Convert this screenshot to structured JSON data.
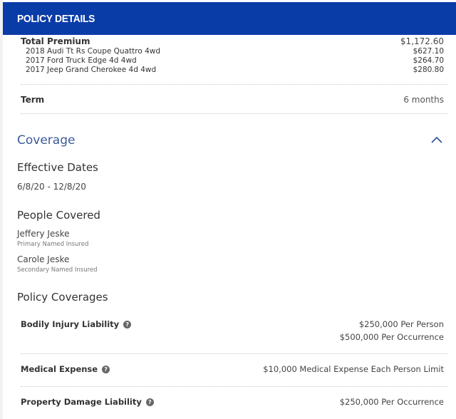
{
  "header": {
    "title": "POLICY DETAILS"
  },
  "premium": {
    "label": "Total Premium",
    "amount": "$1,172.60",
    "vehicles": [
      {
        "name": "2018 Audi Tt Rs Coupe Quattro 4wd",
        "amount": "$627.10"
      },
      {
        "name": "2017 Ford Truck Edge 4d 4wd",
        "amount": "$264.70"
      },
      {
        "name": "2017 Jeep Grand Cherokee 4d 4wd",
        "amount": "$280.80"
      }
    ]
  },
  "term": {
    "label": "Term",
    "value": "6 months"
  },
  "coverage": {
    "title": "Coverage",
    "effective": {
      "title": "Effective Dates",
      "value": "6/8/20 - 12/8/20"
    },
    "people": {
      "title": "People Covered",
      "list": [
        {
          "name": "Jeffery Jeske",
          "role": "Primary Named Insured"
        },
        {
          "name": "Carole Jeske",
          "role": "Secondary Named Insured"
        }
      ]
    },
    "policy": {
      "title": "Policy Coverages",
      "items": [
        {
          "label": "Bodily Injury Liability",
          "values": [
            "$250,000 Per Person",
            "$500,000 Per Occurrence"
          ]
        },
        {
          "label": "Medical Expense",
          "values": [
            "$10,000 Medical Expense Each Person Limit"
          ]
        },
        {
          "label": "Property Damage Liability",
          "values": [
            "$250,000 Per Occurrence"
          ]
        }
      ]
    }
  }
}
